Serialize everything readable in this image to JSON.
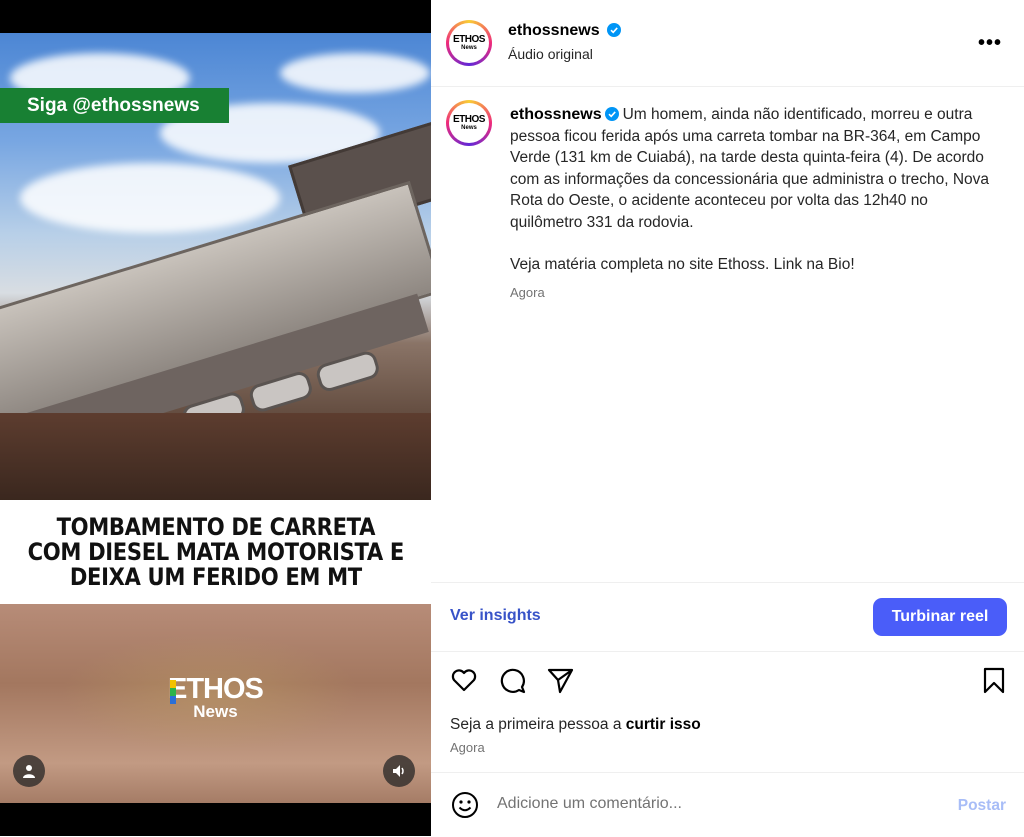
{
  "media": {
    "follow_banner": "Siga @ethossnews",
    "headline": "TOMBAMENTO DE CARRETA\nCOM DIESEL MATA MOTORISTA E\nDEIXA UM FERIDO EM MT",
    "watermark_line1": "ETHOS",
    "watermark_line2": "News",
    "user_tag_icon": "person-icon",
    "audio_icon": "speaker-icon"
  },
  "header": {
    "avatar_text1": "ETHOS",
    "avatar_text2": "News",
    "username": "ethossnews",
    "subtitle": "Áudio original",
    "more_label": "•••"
  },
  "caption": {
    "username": "ethossnews",
    "text": "Um homem, ainda não identificado, morreu e outra pessoa ficou ferida após uma carreta tombar na BR-364, em Campo Verde (131 km de Cuiabá), na tarde desta quinta-feira (4). De acordo com as informações da concessionária que administra o trecho, Nova Rota do Oeste, o acidente aconteceu por volta das 12h40 no quilômetro 331 da rodovia.",
    "text2": "Veja matéria completa no site Ethoss. Link na Bio!",
    "time": "Agora"
  },
  "insights": {
    "link_label": "Ver insights",
    "boost_label": "Turbinar reel"
  },
  "likes": {
    "prefix": "Seja a primeira pessoa a ",
    "bold": "curtir isso",
    "time": "Agora"
  },
  "comment": {
    "placeholder": "Adicione um comentário...",
    "post_label": "Postar"
  },
  "colors": {
    "accent": "#4a5df9",
    "link": "#3853c8",
    "verified": "#0095f6",
    "banner_green": "#188033"
  }
}
